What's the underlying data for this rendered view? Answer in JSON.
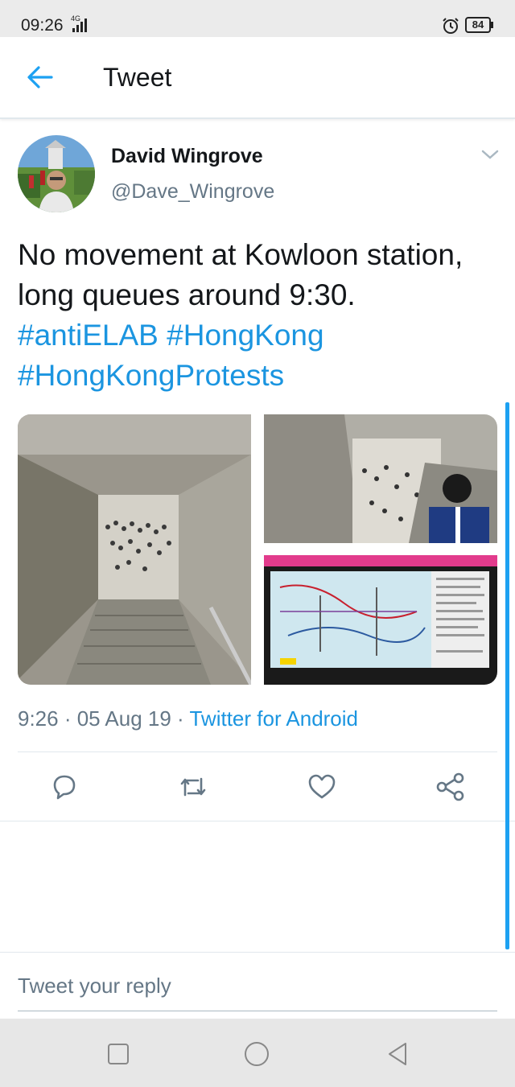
{
  "status_bar": {
    "time": "09:26",
    "network": "4G",
    "battery": "84"
  },
  "header": {
    "title": "Tweet",
    "back_icon": "arrow-left-icon"
  },
  "tweet": {
    "author_name": "David Wingrove",
    "author_handle": "@Dave_Wingrove",
    "text_plain": "No movement at Kowloon station, long queues around 9:30. ",
    "hashtags": [
      "#antiELAB",
      "#HongKong",
      "#HongKongProtests"
    ],
    "timestamp": "9:26 · 05 Aug 19 · ",
    "client": "Twitter for Android",
    "media_count": 3
  },
  "actions": [
    {
      "name": "reply-icon"
    },
    {
      "name": "retweet-icon"
    },
    {
      "name": "like-icon"
    },
    {
      "name": "share-icon"
    }
  ],
  "reply": {
    "placeholder": "Tweet your reply"
  },
  "colors": {
    "accent": "#1da1f2",
    "link": "#1b95e0",
    "secondary_text": "#657786"
  }
}
